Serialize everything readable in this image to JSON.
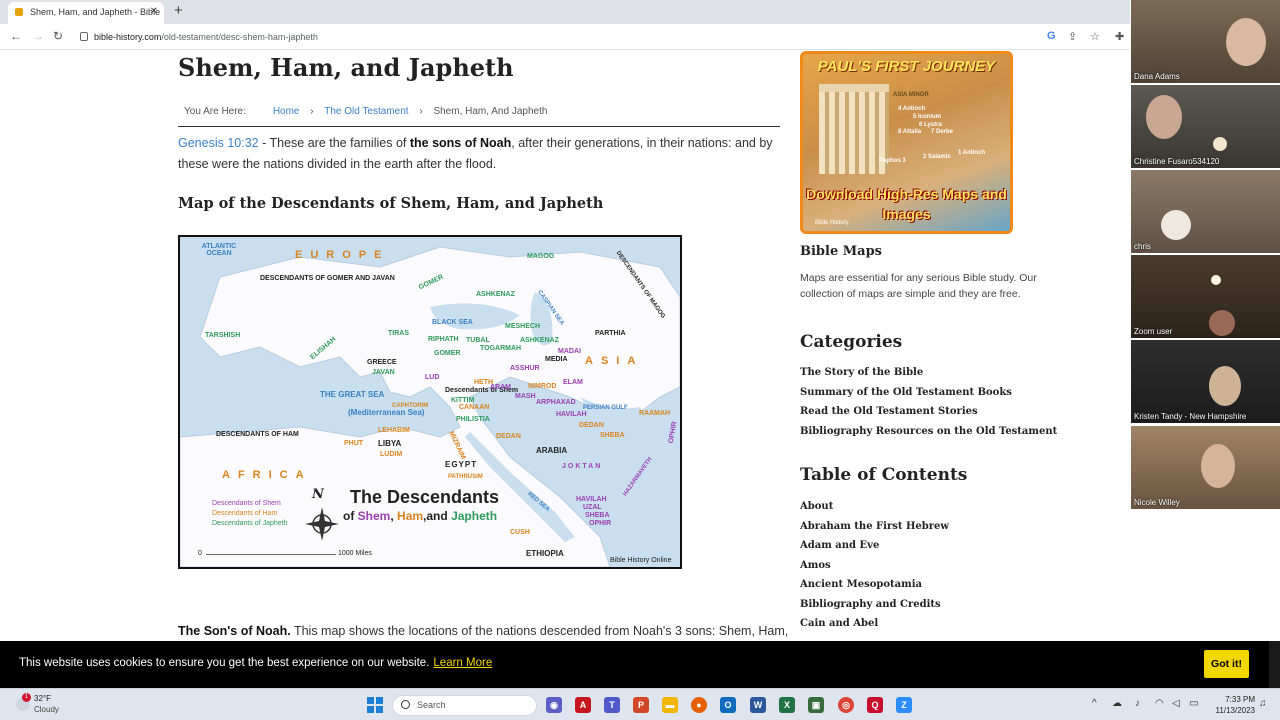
{
  "browser": {
    "tab_title": "Shem, Ham, and Japheth - Bible",
    "tab_close": "✕",
    "new_tab": "+",
    "url_host": "bible-history.com",
    "url_path": "/old-testament/desc-shem-ham-japheth"
  },
  "article": {
    "title": "Shem, Ham, and Japheth",
    "breadcrumb": {
      "prefix": "You Are Here:",
      "home": "Home",
      "section": "The Old Testament",
      "current": "Shem, Ham, And Japheth",
      "separator": "›"
    },
    "intro": {
      "ref": "Genesis 10:32",
      "text1": " - These are the families of ",
      "bold": "the sons of Noah",
      "text2": ", after their generations, in their nations: and by these were the nations divided in the earth after the flood."
    },
    "map_heading": "Map of the Descendants of Shem, Ham, and Japheth",
    "description_bold": "The Son's of Noah.",
    "description_text": " This map shows the locations of the nations descended from Noah's 3 sons: Shem, Ham,"
  },
  "map": {
    "labels": {
      "atlantic": "ATLANTIC\nOCEAN",
      "europe": "EUROPE",
      "gomer_javan": "DESCENDANTS OF GOMER AND JAVAN",
      "gomer_top": "GOMER",
      "magog": "MAGOG",
      "desc_magog": "DESCENDANTS OF MAGOG",
      "ashkenaz1": "ASHKENAZ",
      "caspian": "CASPIAN SEA",
      "tarshish": "TARSHISH",
      "black_sea": "BLACK SEA",
      "meshech": "MESHECH",
      "parthia": "PARTHIA",
      "tiras": "TIRAS",
      "riphath": "RIPHATH",
      "tubal": "TUBAL",
      "ashkenaz2": "ASHKENAZ",
      "togarmah": "TOGARMAH",
      "elishah": "ELISHAH",
      "gomer2": "GOMER",
      "madai": "MADAI",
      "media": "MEDIA",
      "asia": "ASIA",
      "greece": "GREECE",
      "javan": "JAVAN",
      "asshur": "ASSHUR",
      "lud": "LUD",
      "heth": "HETH",
      "desc_shem": "Descendants of Shem",
      "elam": "ELAM",
      "great_sea": "THE GREAT SEA",
      "aram": "ARAM",
      "nimrod": "NIMROD",
      "kittim": "KITTIM",
      "mash": "MASH",
      "arphaxad": "ARPHAXAD",
      "caphtorim": "CAPHTORIM",
      "canaan": "CANAAN",
      "havilah1": "HAVILAH",
      "persian_gulf": "PERSIAN GULF",
      "raamah": "RAAMAH",
      "mediterranean": "(Mediterranean Sea)",
      "philistia": "PHILISTIA",
      "dedan1": "DEDAN",
      "desc_ham": "DESCENDANTS OF HAM",
      "lehabim": "LEHABIM",
      "dedan2": "DEDAN",
      "sheba1": "SHEBA",
      "ophir1": "OPHIR",
      "phut": "PHUT",
      "libya": "LIBYA",
      "mizraim": "MIZRAIM",
      "ludim": "LUDIM",
      "arabia": "ARABIA",
      "africa": "AFRICA",
      "egypt": "EGYPT",
      "joktan": "JOKTAN",
      "pathrusim": "PATHRUSIM",
      "hazarmaveth": "HAZARMAVETH",
      "red_sea": "RED SEA",
      "havilah2": "HAVILAH",
      "uzal": "UZAL",
      "sheba2": "SHEBA",
      "ophir2": "OPHIR",
      "cush": "CUSH",
      "ethiopia": "ETHIOPIA",
      "scale_zero": "0",
      "scale_miles": "1000 Miles",
      "credit": "Bible History Online",
      "legend_shem": "Descendants of Shem",
      "legend_ham": "Descendants of Ham",
      "legend_japheth": "Descendants of Japheth",
      "big_title": "The Descendants",
      "sub_of": "of ",
      "sub_shem": "Shem",
      "sub_comma": ", ",
      "sub_ham": "Ham",
      "sub_and": ",and ",
      "sub_japheth": "Japheth",
      "compass_n": "N"
    }
  },
  "sidebar": {
    "promo": {
      "title": "PAUL'S FIRST JOURNEY",
      "asia_minor": "ASIA MINOR",
      "routes": [
        "4 Antioch",
        "5 Iconium",
        "6 Lystra",
        "8 Attalia",
        "7 Derbe",
        "1 Antioch",
        "Paphos 3",
        "2 Salamis"
      ],
      "download": "Download High-Res Maps and Images",
      "brand": "Bible History"
    },
    "bible_maps_heading": "Bible Maps",
    "bible_maps_text": "Maps are essential for any serious Bible study. Our collection of maps are simple and they are free.",
    "categories_heading": "Categories",
    "categories": [
      "The Story of the Bible",
      "Summary of the Old Testament Books",
      "Read the Old Testament Stories",
      "Bibliography Resources on the Old Testament"
    ],
    "toc_heading": "Table of Contents",
    "toc": [
      "About",
      "Abraham the First Hebrew",
      "Adam and Eve",
      "Amos",
      "Ancient Mesopotamia",
      "Bibliography and Credits",
      "Cain and Abel"
    ]
  },
  "cookie": {
    "message": "This website uses cookies to ensure you get the best experience on our website.",
    "learn_more": "Learn More",
    "button": "Got it!"
  },
  "participants": [
    {
      "name": "Dana Adams",
      "bg": "#6b5a48"
    },
    {
      "name": "Christine Fusaro534120",
      "bg": "#4a4640"
    },
    {
      "name": "chris",
      "bg": "#7a6a5a"
    },
    {
      "name": "Zoom user",
      "bg": "#5a4a38"
    },
    {
      "name": "Kristen Tandy - New Hampshire",
      "bg": "#2c2c2c"
    },
    {
      "name": "Nicole Willey",
      "bg": "#8a7258"
    }
  ],
  "taskbar": {
    "weather_temp": "32°F",
    "weather_desc": "Cloudy",
    "weather_badge": "1",
    "search_placeholder": "Search",
    "time": "7:33 PM",
    "date": "11/13/2023"
  },
  "colors": {
    "link": "#3b82c4",
    "cookie_button": "#f1d600",
    "promo_border": "#f08a1a",
    "shem": "#9b3fb0",
    "ham": "#d9831f",
    "japheth": "#2e9a5b"
  }
}
